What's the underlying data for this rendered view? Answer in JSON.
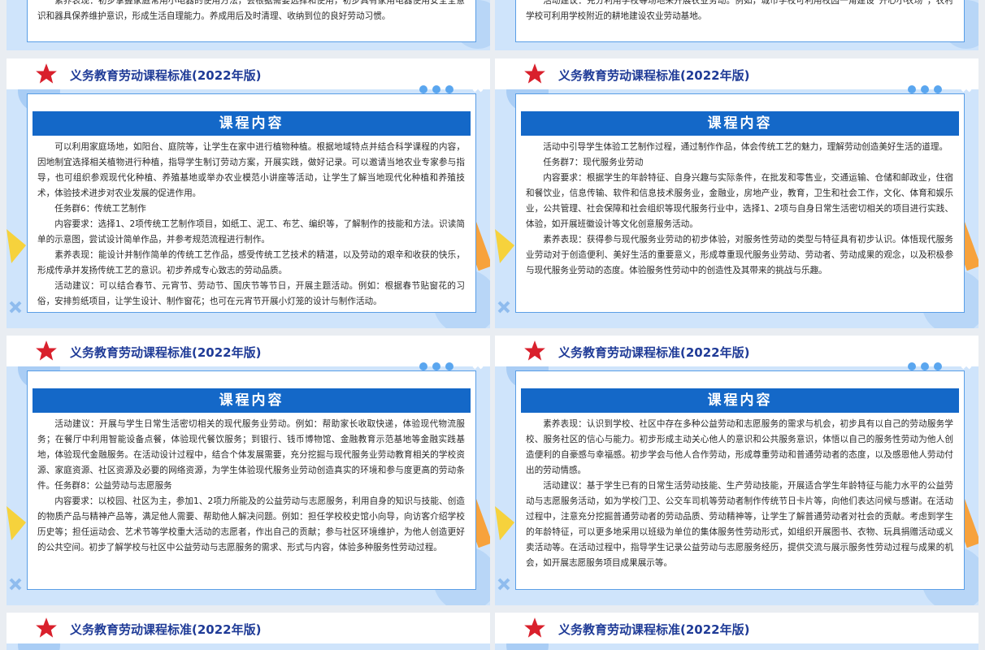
{
  "header_title": "义务教育劳动课程标准(2022年版)",
  "card_heading": "课程内容",
  "colors": {
    "accent": "#1468c8",
    "title": "#1f3b97",
    "star": "#d9202c",
    "bg_blue": "#cfe4fb"
  },
  "top_left": {
    "paragraphs": [
      "素养表现：初步掌握家庭常用小电器的使用方法，会根据需要选择和使用，初步具有家用电器使用安全全意识和器具保养维护意识，形成生活自理能力。养成用后及时清理、收纳到位的良好劳动习惯。"
    ]
  },
  "top_right": {
    "paragraphs": [
      "活动建议：充分利用学校等场地来开展农业劳动。例如，城市学校可利用校园一角建设“开心小农场”，农村学校可利用学校附近的耕地建设农业劳动基地。"
    ]
  },
  "slide_1_left": {
    "paragraphs": [
      "可以利用家庭场地，如阳台、庭院等，让学生在家中进行植物种植。根据地域特点并结合科学课程的内容，因地制宜选择相关植物进行种植，指导学生制订劳动方案，开展实践，做好记录。可以邀请当地农业专家参与指导，也可组织参观现代化种植、养殖基地或举办农业模范小讲座等活动，让学生了解当地现代化种植和养殖技术，体验技术进步对农业发展的促进作用。",
      "任务群6：传统工艺制作",
      "内容要求：选择1、2项传统工艺制作项目，如纸工、泥工、布艺、编织等，了解制作的技能和方法。识读简单的示意图，尝试设计简单作品，并参考规范流程进行制作。",
      "素养表现：能设计并制作简单的传统工艺作品，感受传统工艺技术的精湛，以及劳动的艰辛和收获的快乐，形成传承并发扬传统工艺的意识。初步养成专心致志的劳动品质。",
      "活动建议：可以结合春节、元宵节、劳动节、国庆节等节日，开展主题活动。例如：根据春节贴窗花的习俗，安排剪纸项目，让学生设计、制作窗花；也可在元宵节开展小灯笼的设计与制作活动。"
    ]
  },
  "slide_1_right": {
    "paragraphs": [
      "活动中引导学生体验工艺制作过程，通过制作作品，体会传统工艺的魅力，理解劳动创造美好生活的道理。",
      "任务群7：现代服务业劳动",
      "内容要求：根据学生的年龄特征、自身兴趣与实际条件，在批发和零售业，交通运输、仓储和邮政业，住宿和餐饮业，信息传输、软件和信息技术服务业，金融业，房地产业，教育，卫生和社会工作，文化、体育和娱乐业，公共管理、社会保障和社会组织等现代服务行业中，选择1、2项与自身日常生活密切相关的项目进行实践、体验，如开展班徽设计等文化创意服务活动。",
      "素养表现：获得参与现代服务业劳动的初步体验，对服务性劳动的类型与特征具有初步认识。体悟现代服务业劳动对于创造便利、美好生活的重要意义，形成尊重现代服务业劳动、劳动者、劳动成果的观念，以及积极参与现代服务业劳动的态度。体验服务性劳动中的创造性及其带来的挑战与乐趣。"
    ]
  },
  "slide_2_left": {
    "paragraphs": [
      "活动建议：开展与学生日常生活密切相关的现代服务业劳动。例如：帮助家长收取快递，体验现代物流服务；在餐厅中利用智能设备点餐，体验现代餐饮服务；到银行、钱币博物馆、金融教育示范基地等金融实践基地，体验现代金融服务。在活动设计过程中，结合个体发展需要，充分挖掘与现代服务业劳动教育相关的学校资源、家庭资源、社区资源及必要的网络资源，为学生体验现代服务业劳动创造真实的环境和参与度更高的劳动条件。任务群8：公益劳动与志愿服务",
      "内容要求：以校园、社区为主，参加1、2项力所能及的公益劳动与志愿服务，利用自身的知识与技能、创造的物质产品与精神产品等，满足他人需要、帮助他人解决问题。例如：担任学校校史馆小向导，向访客介绍学校历史等；担任运动会、艺术节等学校重大活动的志愿者，作出自己的贡献；参与社区环境维护，为他人创造更好的公共空间。初步了解学校与社区中公益劳动与志愿服务的需求、形式与内容，体验多种服务性劳动过程。"
    ]
  },
  "slide_2_right": {
    "paragraphs": [
      "素养表现：认识到学校、社区中存在多种公益劳动和志愿服务的需求与机会，初步具有以自己的劳动服务学校、服务社区的信心与能力。初步形成主动关心他人的意识和公共服务意识，体悟以自己的服务性劳动为他人创造便利的自豪感与幸福感。初步学会与他人合作劳动，形成尊重劳动和普通劳动者的态度，以及感恩他人劳动付出的劳动情感。",
      "活动建议：基于学生已有的日常生活劳动技能、生产劳动技能，开展适合学生年龄特征与能力水平的公益劳动与志愿服务活动，如为学校门卫、公交车司机等劳动者制作传统节日卡片等，向他们表达问候与感谢。在活动过程中，注意充分挖掘普通劳动者的劳动品质、劳动精神等，让学生了解普通劳动者对社会的贡献。考虑到学生的年龄特征，可以更多地采用以班级为单位的集体服务性劳动形式，如组织开展图书、衣物、玩具捐赠活动或义卖活动等。在活动过程中，指导学生记录公益劳动与志愿服务经历，提供交流与展示服务性劳动过程与成果的机会，如开展志愿服务项目成果展示等。"
    ]
  }
}
